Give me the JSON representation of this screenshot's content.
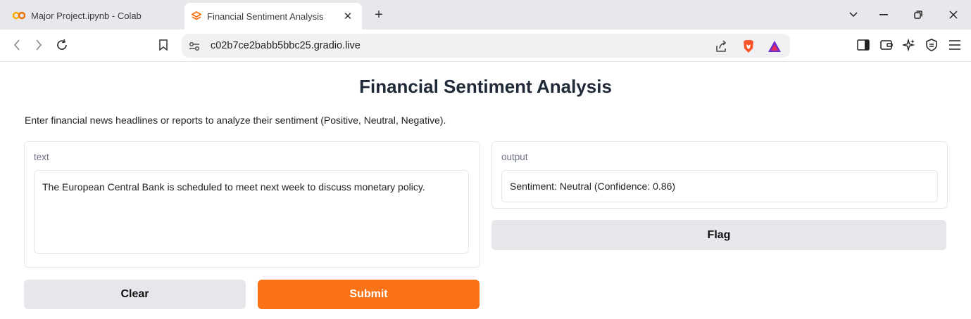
{
  "browser": {
    "tabs": [
      {
        "title": "Major Project.ipynb - Colab",
        "active": false,
        "icon": "colab-icon"
      },
      {
        "title": "Financial Sentiment Analysis",
        "active": true,
        "icon": "gradio-icon"
      }
    ],
    "address": "c02b7ce2babb5bbc25.gradio.live",
    "colors": {
      "tabbar": "#e8e8ec",
      "brave": "#fb542b"
    }
  },
  "app": {
    "title": "Financial Sentiment Analysis",
    "description": "Enter financial news headlines or reports to analyze their sentiment (Positive, Neutral, Negative).",
    "input": {
      "label": "text",
      "value": "The European Central Bank is scheduled to meet next week to discuss monetary policy."
    },
    "output": {
      "label": "output",
      "value": "Sentiment: Neutral (Confidence: 0.86)"
    },
    "buttons": {
      "clear": "Clear",
      "submit": "Submit",
      "flag": "Flag"
    },
    "colors": {
      "submit": "#f97316",
      "secondary": "#e5e7eb"
    }
  }
}
